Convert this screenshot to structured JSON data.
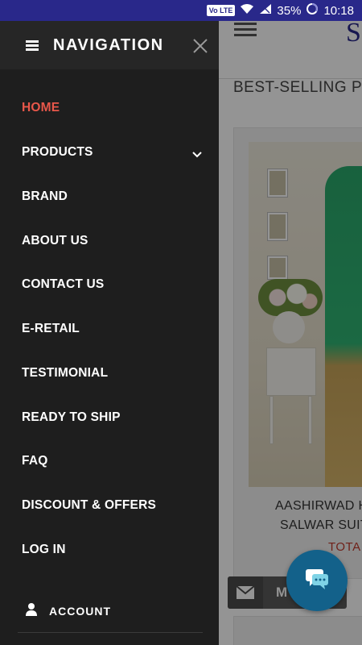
{
  "status_bar": {
    "volte": "Vo LTE",
    "battery": "35%",
    "time": "10:18"
  },
  "app": {
    "logo_letter": "S",
    "section_title": "BEST-SELLING PR",
    "product": {
      "name_line1": "AASHIRWAD H",
      "name_line2": "SALWAR SUIT",
      "price": "TOTA"
    },
    "mail_label": "M"
  },
  "drawer": {
    "title": "NAVIGATION",
    "items": [
      {
        "label": "HOME",
        "active": true
      },
      {
        "label": "PRODUCTS",
        "expandable": true
      },
      {
        "label": "BRAND"
      },
      {
        "label": "ABOUT US"
      },
      {
        "label": "CONTACT US"
      },
      {
        "label": "E-RETAIL"
      },
      {
        "label": "TESTIMONIAL"
      },
      {
        "label": "READY TO SHIP"
      },
      {
        "label": "FAQ"
      },
      {
        "label": "DISCOUNT & OFFERS"
      },
      {
        "label": "LOG IN"
      }
    ],
    "account_label": "ACCOUNT"
  },
  "colors": {
    "status_bar": "#29288a",
    "drawer_bg": "#1e1e1e",
    "active_item": "#e8574a",
    "price": "#c0392b",
    "chat_fab": "#13618a"
  },
  "icons": [
    "wifi-icon",
    "signal-icon",
    "battery-icon",
    "hamburger-icon",
    "close-icon",
    "chevron-down-icon",
    "user-icon",
    "mail-icon",
    "chat-icon"
  ]
}
